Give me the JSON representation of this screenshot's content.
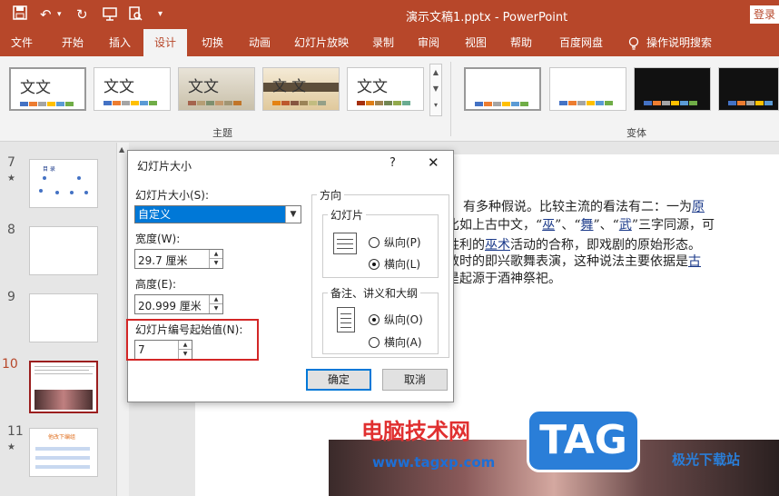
{
  "window": {
    "title": "演示文稿1.pptx  -  PowerPoint",
    "login_label": "登录",
    "qat_icons": [
      "save-icon",
      "undo-icon",
      "redo-icon",
      "slideshow-icon",
      "preview-icon",
      "customize-qat-icon"
    ]
  },
  "tabs": [
    "文件",
    "开始",
    "插入",
    "设计",
    "切换",
    "动画",
    "幻灯片放映",
    "录制",
    "审阅",
    "视图",
    "帮助",
    "百度网盘",
    "操作说明搜索"
  ],
  "active_tab": "设计",
  "ribbon": {
    "themes_group_label": "主题",
    "variants_group_label": "变体",
    "theme_sample_text": "文文",
    "theme_sample_text_alt": "文 文"
  },
  "slides": [
    {
      "number": "7",
      "star": "★",
      "title": "目  录"
    },
    {
      "number": "8"
    },
    {
      "number": "9"
    },
    {
      "number": "10"
    },
    {
      "number": "11",
      "star": "★",
      "title": "他改下编组"
    }
  ],
  "slide_body": {
    "line1": "有多种假说。比较主流的看法有二：一为",
    "line1_link": "原",
    "line2_a": "比如上古中文，“",
    "line2_w1": "巫",
    "line2_b": "”、“",
    "line2_w2": "舞",
    "line2_c": "”、“",
    "line2_w3": "武",
    "line2_d": "”三字同源，可",
    "line3_a": "胜利的",
    "line3_link": "巫术",
    "line3_b": "活动的合称，即戏剧的原始形态。",
    "line4_a": "数时的即兴歌舞表演，这种说法主要依据是",
    "line4_link": "古",
    "line5": "是起源于酒神祭祀。"
  },
  "dialog": {
    "title": "幻灯片大小",
    "help": "?",
    "close": "✕",
    "slide_size_label": "幻灯片大小(S):",
    "slide_size_value": "自定义",
    "width_label": "宽度(W):",
    "width_value": "29.7 厘米",
    "height_label": "高度(E):",
    "height_value": "20.999 厘米",
    "numbering_label": "幻灯片编号起始值(N):",
    "numbering_value": "7",
    "orientation_label": "方向",
    "slides_group_label": "幻灯片",
    "slides_portrait": "纵向(P)",
    "slides_landscape": "横向(L)",
    "slides_selected": "landscape",
    "notes_group_label": "备注、讲义和大纲",
    "notes_portrait": "纵向(O)",
    "notes_landscape": "横向(A)",
    "notes_selected": "portrait",
    "ok": "确定",
    "cancel": "取消"
  },
  "watermark": {
    "text": "电脑技术网",
    "url": "www.tagxp.com",
    "badge": "TAG",
    "corner": "极光下载站"
  },
  "colors": {
    "accent": "#b7472a",
    "selection": "#0078d7",
    "highlight_box": "#d32626"
  }
}
